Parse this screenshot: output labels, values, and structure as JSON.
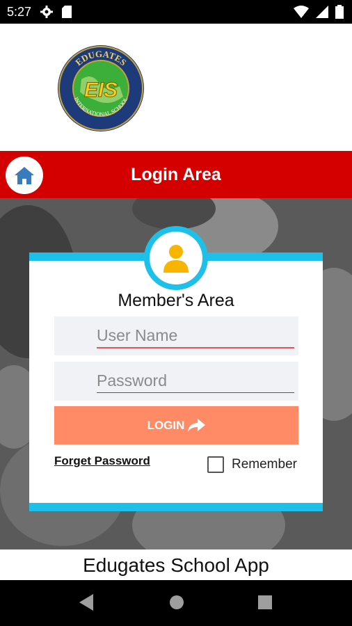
{
  "status_bar": {
    "time": "5:27",
    "icons": [
      "settings-gear-icon",
      "sd-card-icon",
      "wifi-icon",
      "signal-icon",
      "battery-icon"
    ]
  },
  "logo": {
    "text_top": "EDUGATES",
    "text_mid": "EIS",
    "text_bottom": "INTERNATIONAL SCHOOL"
  },
  "header": {
    "title": "Login Area",
    "home_icon": "home-icon"
  },
  "login_card": {
    "title": "Member's Area",
    "username_placeholder": "User Name",
    "username_value": "",
    "password_placeholder": "Password",
    "password_value": "",
    "login_label": "LOGIN",
    "forgot_label": "Forget Password",
    "remember_label": "Remember",
    "remember_checked": false
  },
  "footer": {
    "app_name": "Edugates School App"
  },
  "colors": {
    "red": "#d40000",
    "cyan": "#1ec0ea",
    "login_button": "#ff8a65",
    "avatar_yellow": "#f7b500",
    "home_icon": "#3a7bbd"
  },
  "nav_bar": {
    "icons": [
      "back-icon",
      "home-circle-icon",
      "recents-icon"
    ]
  }
}
